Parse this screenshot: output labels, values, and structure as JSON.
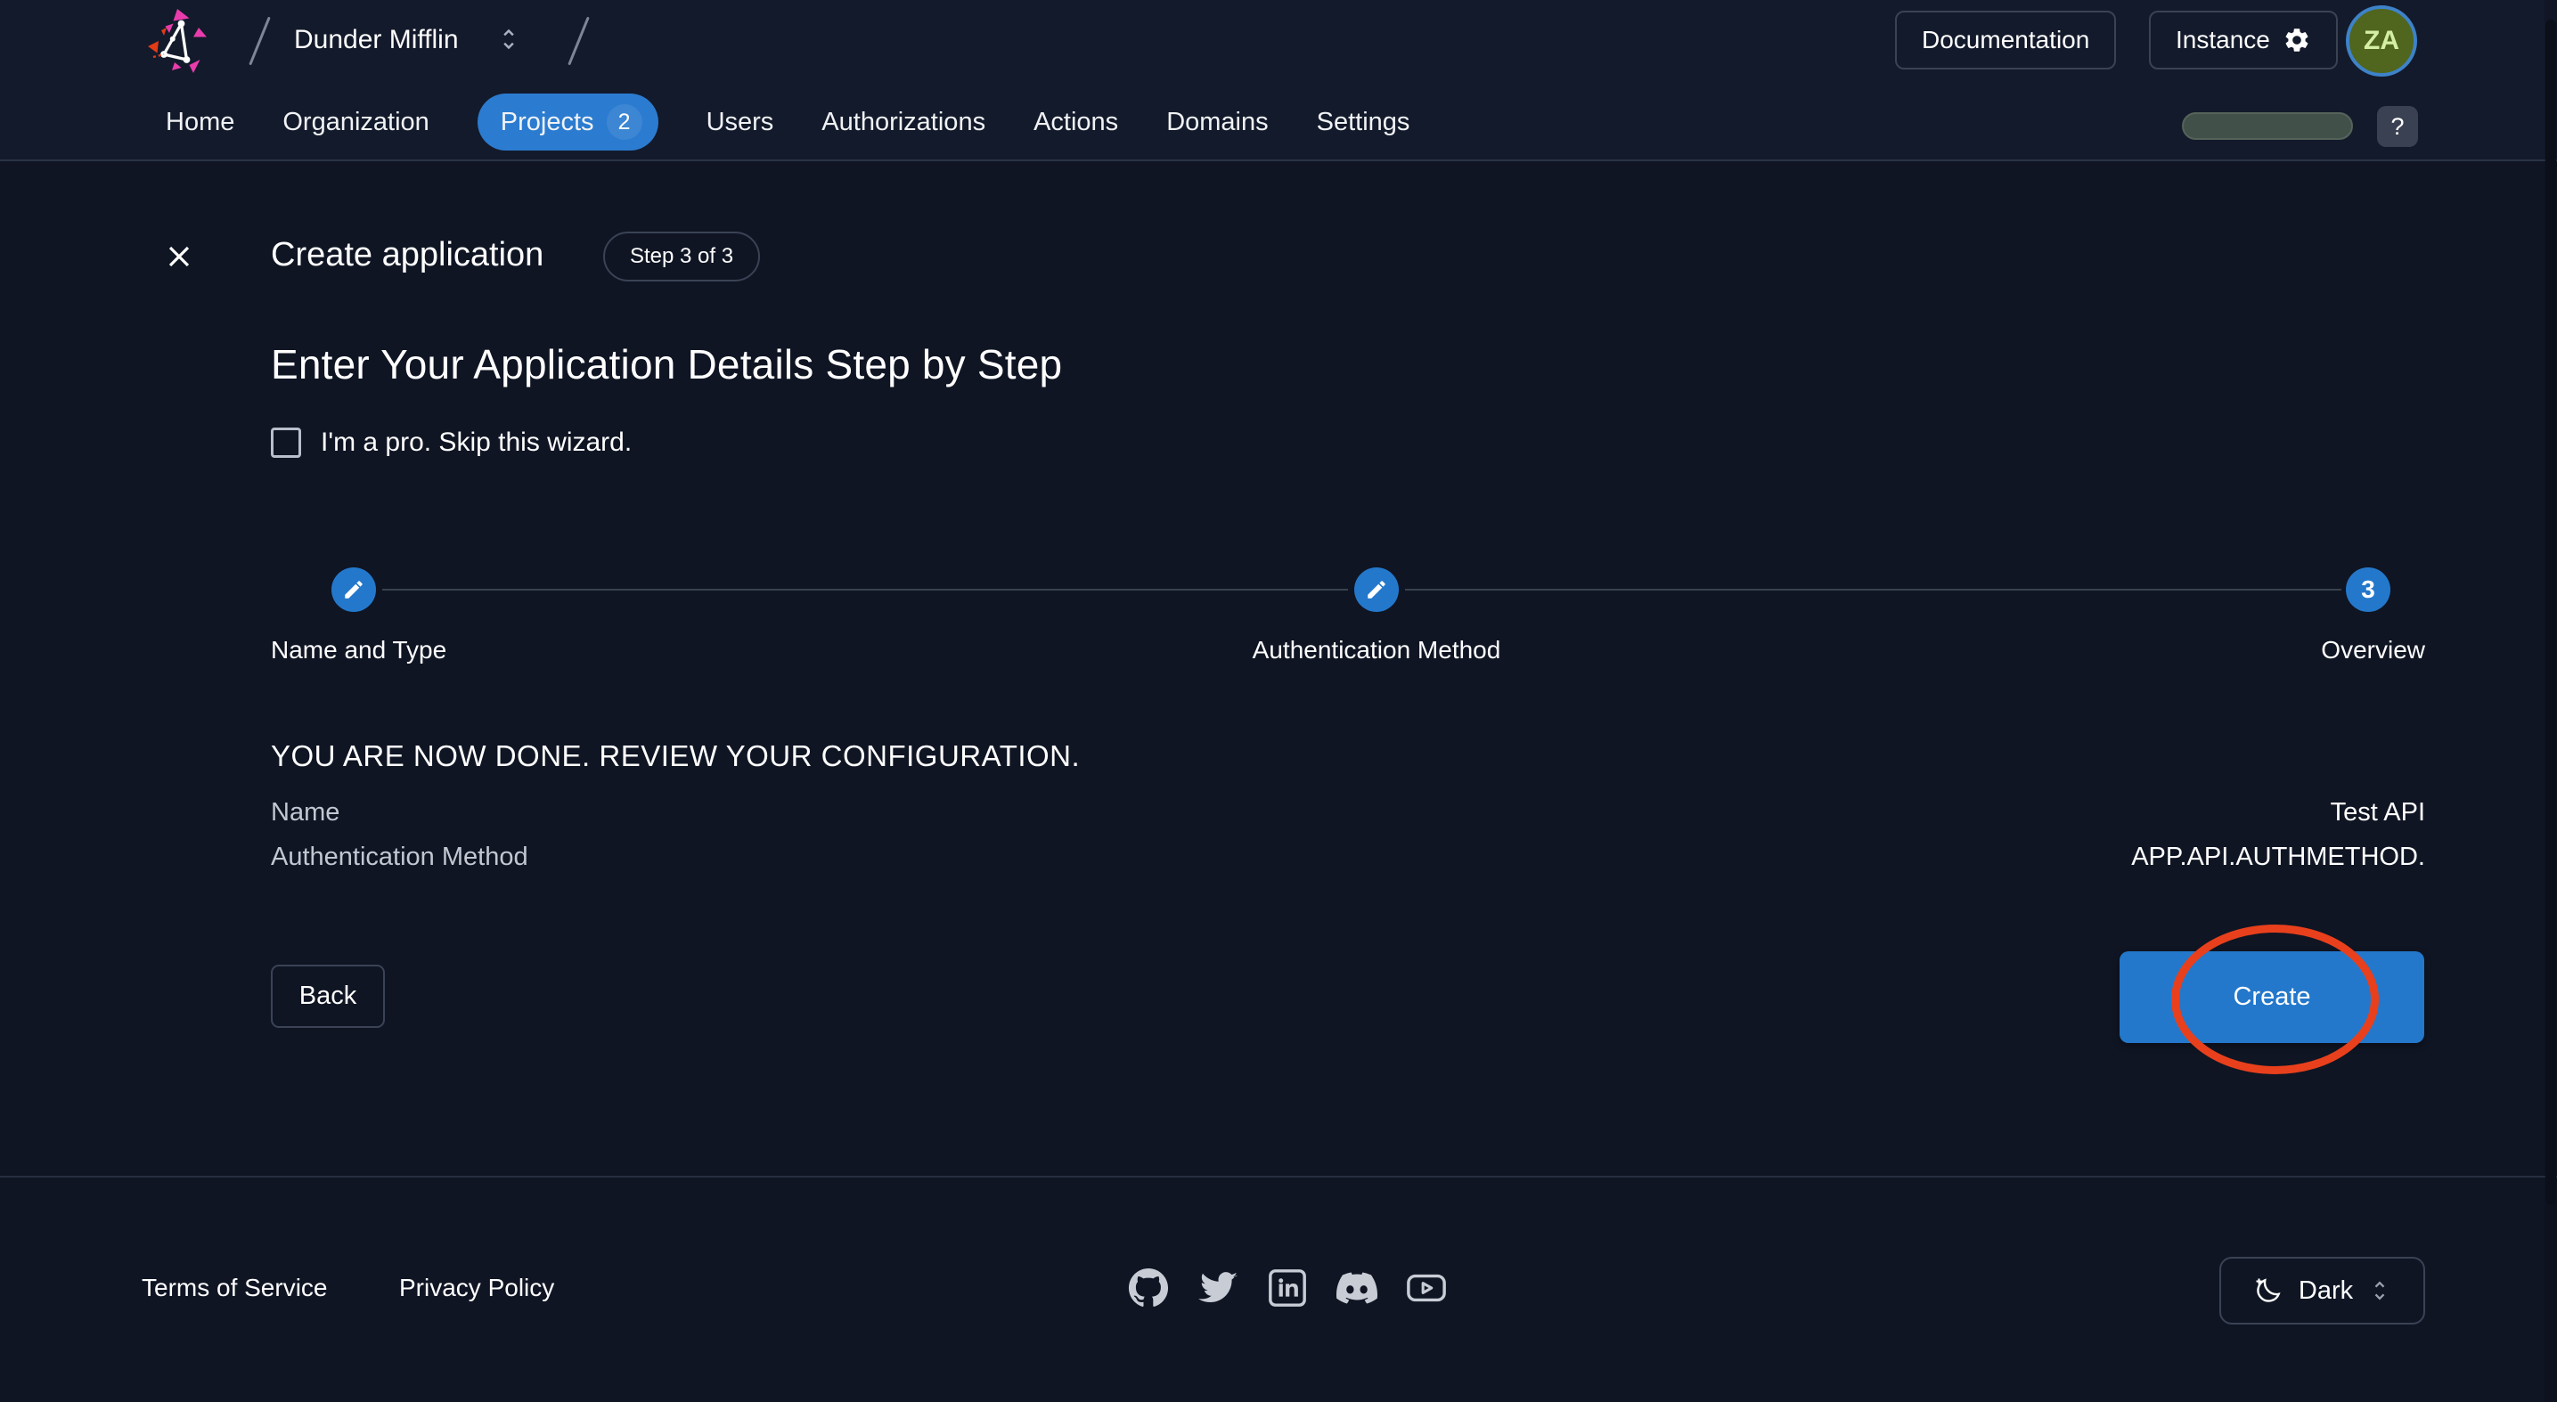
{
  "header": {
    "org_name": "Dunder Mifflin",
    "documentation_button": "Documentation",
    "instance_button": "Instance",
    "avatar_initials": "ZA",
    "help_button": "?"
  },
  "nav": {
    "items": [
      {
        "label": "Home",
        "active": false
      },
      {
        "label": "Organization",
        "active": false
      },
      {
        "label": "Projects",
        "active": true,
        "badge": "2"
      },
      {
        "label": "Users",
        "active": false
      },
      {
        "label": "Authorizations",
        "active": false
      },
      {
        "label": "Actions",
        "active": false
      },
      {
        "label": "Domains",
        "active": false
      },
      {
        "label": "Settings",
        "active": false
      }
    ]
  },
  "wizard": {
    "title": "Create application",
    "step_indicator": "Step 3 of 3",
    "heading": "Enter Your Application Details Step by Step",
    "skip_checkbox_label": "I'm a pro. Skip this wizard.",
    "skip_checkbox_checked": false,
    "steps": [
      {
        "label": "Name and Type",
        "icon": "pencil-icon"
      },
      {
        "label": "Authentication Method",
        "icon": "pencil-icon"
      },
      {
        "label": "Overview",
        "number": "3"
      }
    ],
    "review": {
      "heading": "YOU ARE NOW DONE. REVIEW YOUR CONFIGURATION.",
      "rows": [
        {
          "label": "Name",
          "value": "Test API"
        },
        {
          "label": "Authentication Method",
          "value": "APP.API.AUTHMETHOD."
        }
      ]
    },
    "back_button": "Back",
    "create_button": "Create"
  },
  "footer": {
    "links": [
      {
        "label": "Terms of Service"
      },
      {
        "label": "Privacy Policy"
      }
    ],
    "social_icons": [
      "github-icon",
      "twitter-icon",
      "linkedin-icon",
      "discord-icon",
      "youtube-icon"
    ],
    "theme_selector": {
      "value": "Dark"
    }
  },
  "colors": {
    "accent_blue": "#2478cb",
    "nav_active_pill": "#2b7cd0",
    "annotation_red": "#e8401c",
    "avatar_background": "#50651d",
    "avatar_ring": "#3e82c8",
    "header_background": "#131a2b",
    "page_background": "#0f1523",
    "logo_magenta": "#e93cac",
    "logo_red": "#e23b17"
  }
}
